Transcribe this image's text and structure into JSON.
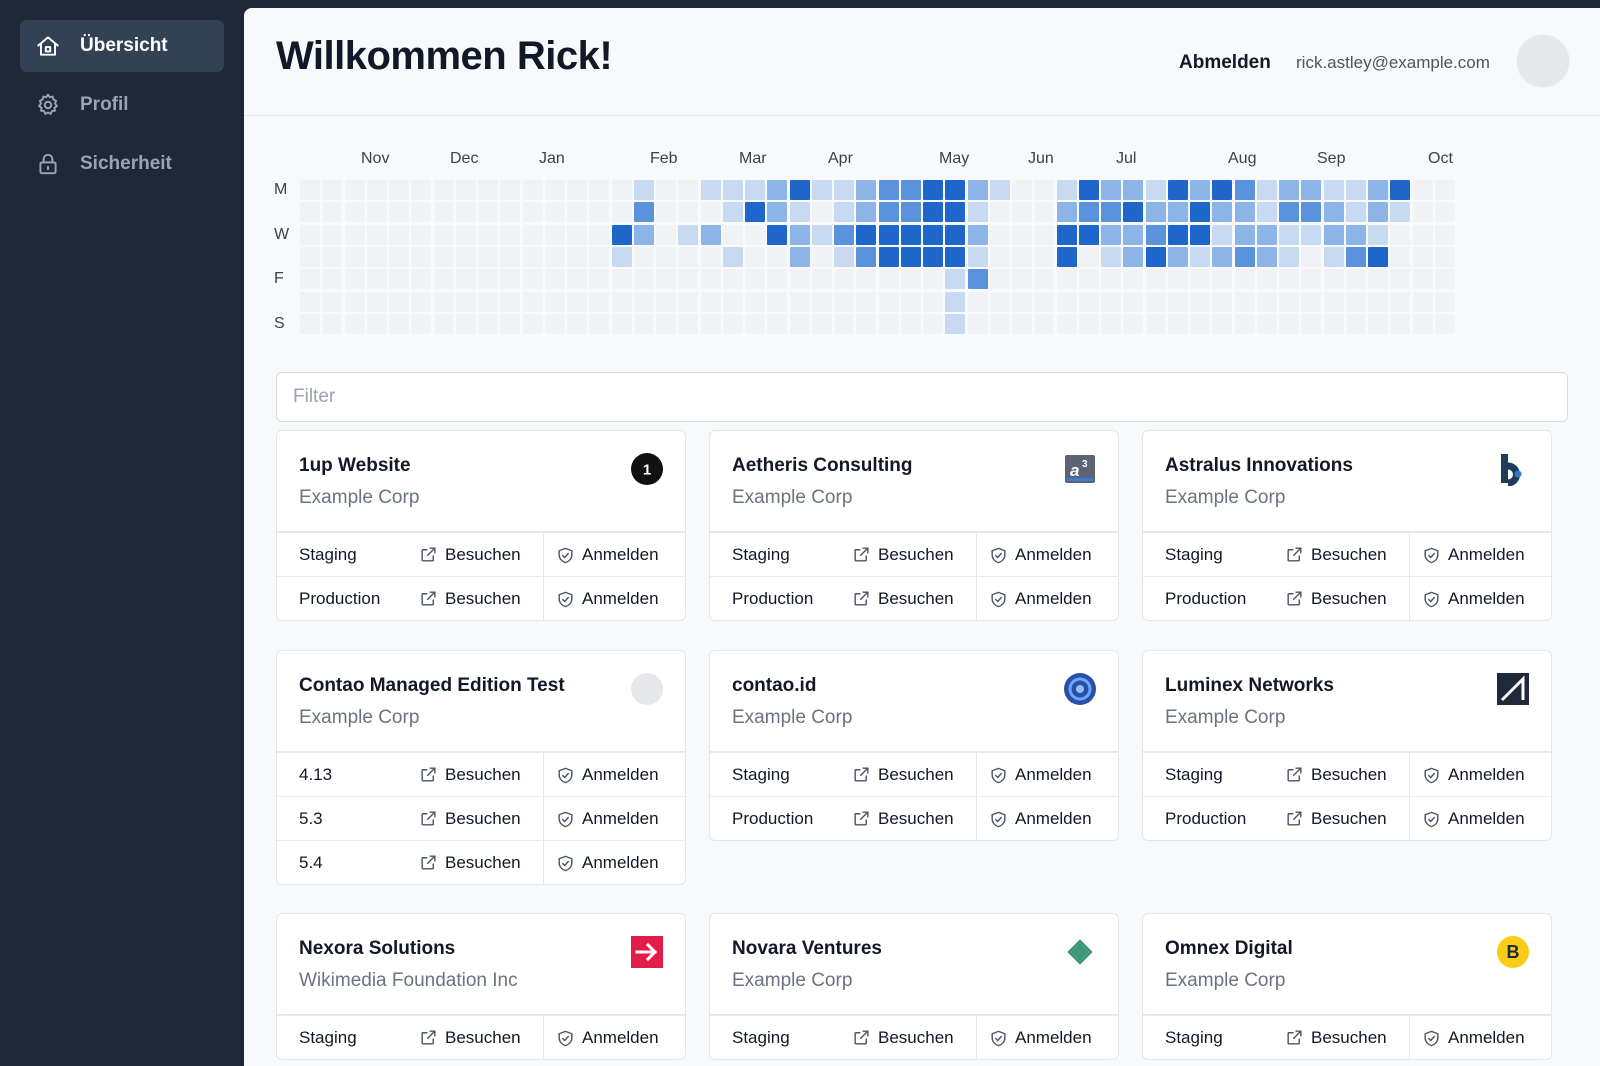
{
  "sidebar": {
    "items": [
      {
        "label": "Übersicht",
        "icon": "home-icon",
        "active": true
      },
      {
        "label": "Profil",
        "icon": "gear-icon",
        "active": false
      },
      {
        "label": "Sicherheit",
        "icon": "lock-icon",
        "active": false
      }
    ]
  },
  "header": {
    "title": "Willkommen Rick!",
    "logout_label": "Abmelden",
    "email": "rick.astley@example.com"
  },
  "heatmap": {
    "months": [
      "Nov",
      "Dec",
      "Jan",
      "Feb",
      "Mar",
      "Apr",
      "May",
      "Jun",
      "Jul",
      "Aug",
      "Sep",
      "Oct"
    ],
    "day_labels": [
      "M",
      "W",
      "F",
      "S"
    ],
    "levels": [
      "000000000000000100111241123344210014221424312211240000110003",
      "000000000000000300014210123344100023342242213321210001320",
      "000000000000004201200421344444200044223441221122100002420",
      "000000000000001000010020134444100040124212321013400000210",
      "000000000000000000000000000001300000000000000000000000000000004",
      "000000000000000000000000000001000000000000000000000000000000002",
      "000000000000000000000000000001000000000000000000000000000000003"
    ],
    "colors": [
      "#f0f2f6",
      "#c8daf1",
      "#8db4e6",
      "#5a92dc",
      "#1e66c9"
    ]
  },
  "filter": {
    "placeholder": "Filter"
  },
  "actions": {
    "visit_label": "Besuchen",
    "login_label": "Anmelden"
  },
  "cards": [
    {
      "title": "1up Website",
      "subtitle": "Example Corp",
      "logo": "one-badge-icon",
      "envs": [
        "Staging",
        "Production"
      ]
    },
    {
      "title": "Aetheris Consulting",
      "subtitle": "Example Corp",
      "logo": "a3-logo-icon",
      "envs": [
        "Staging",
        "Production"
      ]
    },
    {
      "title": "Astralus Innovations",
      "subtitle": "Example Corp",
      "logo": "be-logo-icon",
      "envs": [
        "Staging",
        "Production"
      ]
    },
    {
      "title": "Contao Managed Edition Test",
      "subtitle": "Example Corp",
      "logo": "grey-circle-icon",
      "envs": [
        "4.13",
        "5.3",
        "5.4"
      ]
    },
    {
      "title": "contao.id",
      "subtitle": "Example Corp",
      "logo": "blue-ring-icon",
      "envs": [
        "Staging",
        "Production"
      ]
    },
    {
      "title": "Luminex Networks",
      "subtitle": "Example Corp",
      "logo": "dark-square-icon",
      "envs": [
        "Staging",
        "Production"
      ]
    },
    {
      "title": "Nexora Solutions",
      "subtitle": "Wikimedia Foundation Inc",
      "logo": "red-arrow-icon",
      "envs": [
        "Staging"
      ]
    },
    {
      "title": "Novara Ventures",
      "subtitle": "Example Corp",
      "logo": "green-diamond-icon",
      "envs": [
        "Staging"
      ]
    },
    {
      "title": "Omnex Digital",
      "subtitle": "Example Corp",
      "logo": "yellow-b-icon",
      "envs": [
        "Staging"
      ]
    }
  ]
}
